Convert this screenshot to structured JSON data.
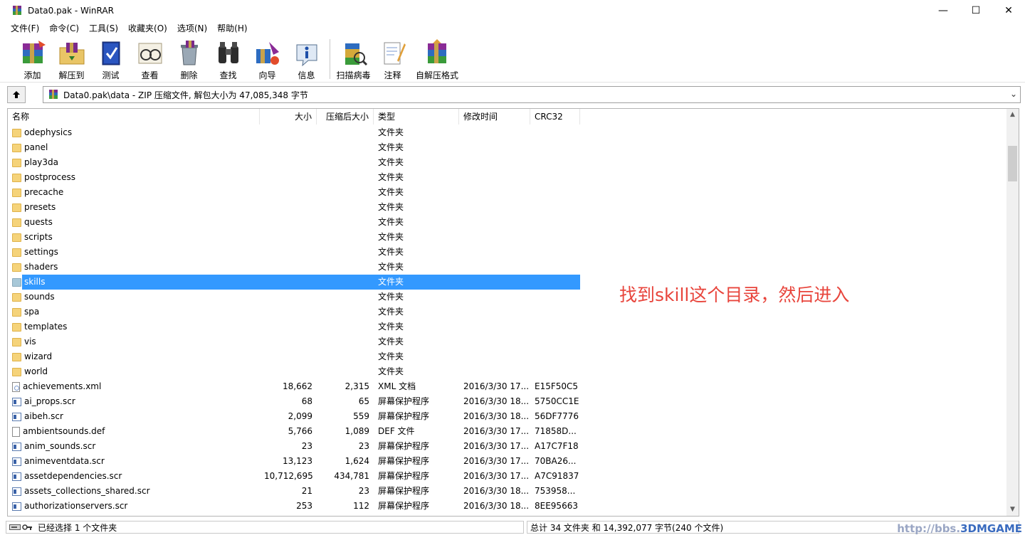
{
  "window": {
    "title": "Data0.pak - WinRAR",
    "minimize_glyph": "—",
    "maximize_glyph": "☐",
    "close_glyph": "✕"
  },
  "menu": [
    "文件(F)",
    "命令(C)",
    "工具(S)",
    "收藏夹(O)",
    "选项(N)",
    "帮助(H)"
  ],
  "toolbar": {
    "add": "添加",
    "extract": "解压到",
    "test": "测试",
    "view": "查看",
    "delete": "删除",
    "find": "查找",
    "wizard": "向导",
    "info": "信息",
    "virus_scan": "扫描病毒",
    "comment": "注释",
    "sfx": "自解压格式"
  },
  "address": {
    "path": "Data0.pak\\data - ZIP 压缩文件, 解包大小为 47,085,348 字节"
  },
  "columns": {
    "name": "名称",
    "size": "大小",
    "packed": "压缩后大小",
    "type": "类型",
    "modified": "修改时间",
    "crc": "CRC32"
  },
  "rows": [
    {
      "name": "odephysics",
      "size": "",
      "packed": "",
      "type": "文件夹",
      "modified": "",
      "crc": "",
      "icon": "folder"
    },
    {
      "name": "panel",
      "size": "",
      "packed": "",
      "type": "文件夹",
      "modified": "",
      "crc": "",
      "icon": "folder"
    },
    {
      "name": "play3da",
      "size": "",
      "packed": "",
      "type": "文件夹",
      "modified": "",
      "crc": "",
      "icon": "folder"
    },
    {
      "name": "postprocess",
      "size": "",
      "packed": "",
      "type": "文件夹",
      "modified": "",
      "crc": "",
      "icon": "folder"
    },
    {
      "name": "precache",
      "size": "",
      "packed": "",
      "type": "文件夹",
      "modified": "",
      "crc": "",
      "icon": "folder"
    },
    {
      "name": "presets",
      "size": "",
      "packed": "",
      "type": "文件夹",
      "modified": "",
      "crc": "",
      "icon": "folder"
    },
    {
      "name": "quests",
      "size": "",
      "packed": "",
      "type": "文件夹",
      "modified": "",
      "crc": "",
      "icon": "folder"
    },
    {
      "name": "scripts",
      "size": "",
      "packed": "",
      "type": "文件夹",
      "modified": "",
      "crc": "",
      "icon": "folder"
    },
    {
      "name": "settings",
      "size": "",
      "packed": "",
      "type": "文件夹",
      "modified": "",
      "crc": "",
      "icon": "folder"
    },
    {
      "name": "shaders",
      "size": "",
      "packed": "",
      "type": "文件夹",
      "modified": "",
      "crc": "",
      "icon": "folder"
    },
    {
      "name": "skills",
      "size": "",
      "packed": "",
      "type": "文件夹",
      "modified": "",
      "crc": "",
      "icon": "folder",
      "selected": true
    },
    {
      "name": "sounds",
      "size": "",
      "packed": "",
      "type": "文件夹",
      "modified": "",
      "crc": "",
      "icon": "folder"
    },
    {
      "name": "spa",
      "size": "",
      "packed": "",
      "type": "文件夹",
      "modified": "",
      "crc": "",
      "icon": "folder"
    },
    {
      "name": "templates",
      "size": "",
      "packed": "",
      "type": "文件夹",
      "modified": "",
      "crc": "",
      "icon": "folder"
    },
    {
      "name": "vis",
      "size": "",
      "packed": "",
      "type": "文件夹",
      "modified": "",
      "crc": "",
      "icon": "folder"
    },
    {
      "name": "wizard",
      "size": "",
      "packed": "",
      "type": "文件夹",
      "modified": "",
      "crc": "",
      "icon": "folder"
    },
    {
      "name": "world",
      "size": "",
      "packed": "",
      "type": "文件夹",
      "modified": "",
      "crc": "",
      "icon": "folder"
    },
    {
      "name": "achievements.xml",
      "size": "18,662",
      "packed": "2,315",
      "type": "XML 文档",
      "modified": "2016/3/30 17...",
      "crc": "E15F50C5",
      "icon": "xml"
    },
    {
      "name": "ai_props.scr",
      "size": "68",
      "packed": "65",
      "type": "屏幕保护程序",
      "modified": "2016/3/30 18...",
      "crc": "5750CC1E",
      "icon": "scr"
    },
    {
      "name": "aibeh.scr",
      "size": "2,099",
      "packed": "559",
      "type": "屏幕保护程序",
      "modified": "2016/3/30 18...",
      "crc": "56DF7776",
      "icon": "scr"
    },
    {
      "name": "ambientsounds.def",
      "size": "5,766",
      "packed": "1,089",
      "type": "DEF 文件",
      "modified": "2016/3/30 17...",
      "crc": "71858D...",
      "icon": "file"
    },
    {
      "name": "anim_sounds.scr",
      "size": "23",
      "packed": "23",
      "type": "屏幕保护程序",
      "modified": "2016/3/30 17...",
      "crc": "A17C7F18",
      "icon": "scr"
    },
    {
      "name": "animeventdata.scr",
      "size": "13,123",
      "packed": "1,624",
      "type": "屏幕保护程序",
      "modified": "2016/3/30 17...",
      "crc": "70BA26...",
      "icon": "scr"
    },
    {
      "name": "assetdependencies.scr",
      "size": "10,712,695",
      "packed": "434,781",
      "type": "屏幕保护程序",
      "modified": "2016/3/30 17...",
      "crc": "A7C91837",
      "icon": "scr"
    },
    {
      "name": "assets_collections_shared.scr",
      "size": "21",
      "packed": "23",
      "type": "屏幕保护程序",
      "modified": "2016/3/30 18...",
      "crc": "753958...",
      "icon": "scr"
    },
    {
      "name": "authorizationservers.scr",
      "size": "253",
      "packed": "112",
      "type": "屏幕保护程序",
      "modified": "2016/3/30 18...",
      "crc": "8EE95663",
      "icon": "scr"
    }
  ],
  "annotation": "找到skill这个目录，然后进入",
  "status": {
    "left": "已经选择 1 个文件夹",
    "right": "总计 34 文件夹 和 14,392,077 字节(240 个文件)"
  },
  "watermark": {
    "url": "http://bbs.",
    "brand": "3DMGAME"
  },
  "colors": {
    "selection": "#3399ff",
    "annotation": "#e8453c",
    "folder": "#f5d37a"
  }
}
